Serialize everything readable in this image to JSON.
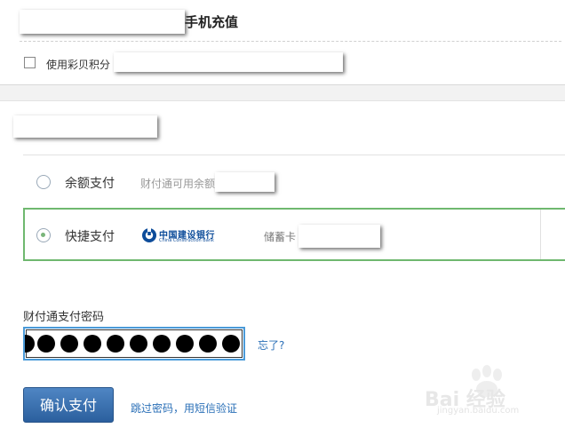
{
  "header": {
    "title": "手机充值"
  },
  "points": {
    "label": "使用彩贝积分",
    "checked": false
  },
  "methods": {
    "balance": {
      "label": "余额支付",
      "hint": "财付通可用余额"
    },
    "quick": {
      "label": "快捷支付",
      "bank_name_cn": "中国建设银行",
      "bank_name_en": "China Construction Bank",
      "card_type": "储蓄卡"
    },
    "selected": "quick"
  },
  "password": {
    "title": "财付通支付密码",
    "forgot_label": "忘了?",
    "masked_digits": 10
  },
  "confirm": {
    "button_label": "确认支付",
    "sms_link": "跳过密码，用短信验证"
  },
  "watermark": {
    "brand": "Bai 经验",
    "url": "jingyan.baidu.com"
  },
  "colors": {
    "accent_green": "#6fb86f",
    "link_blue": "#2a6fb7",
    "button_blue": "#3a6fad"
  }
}
